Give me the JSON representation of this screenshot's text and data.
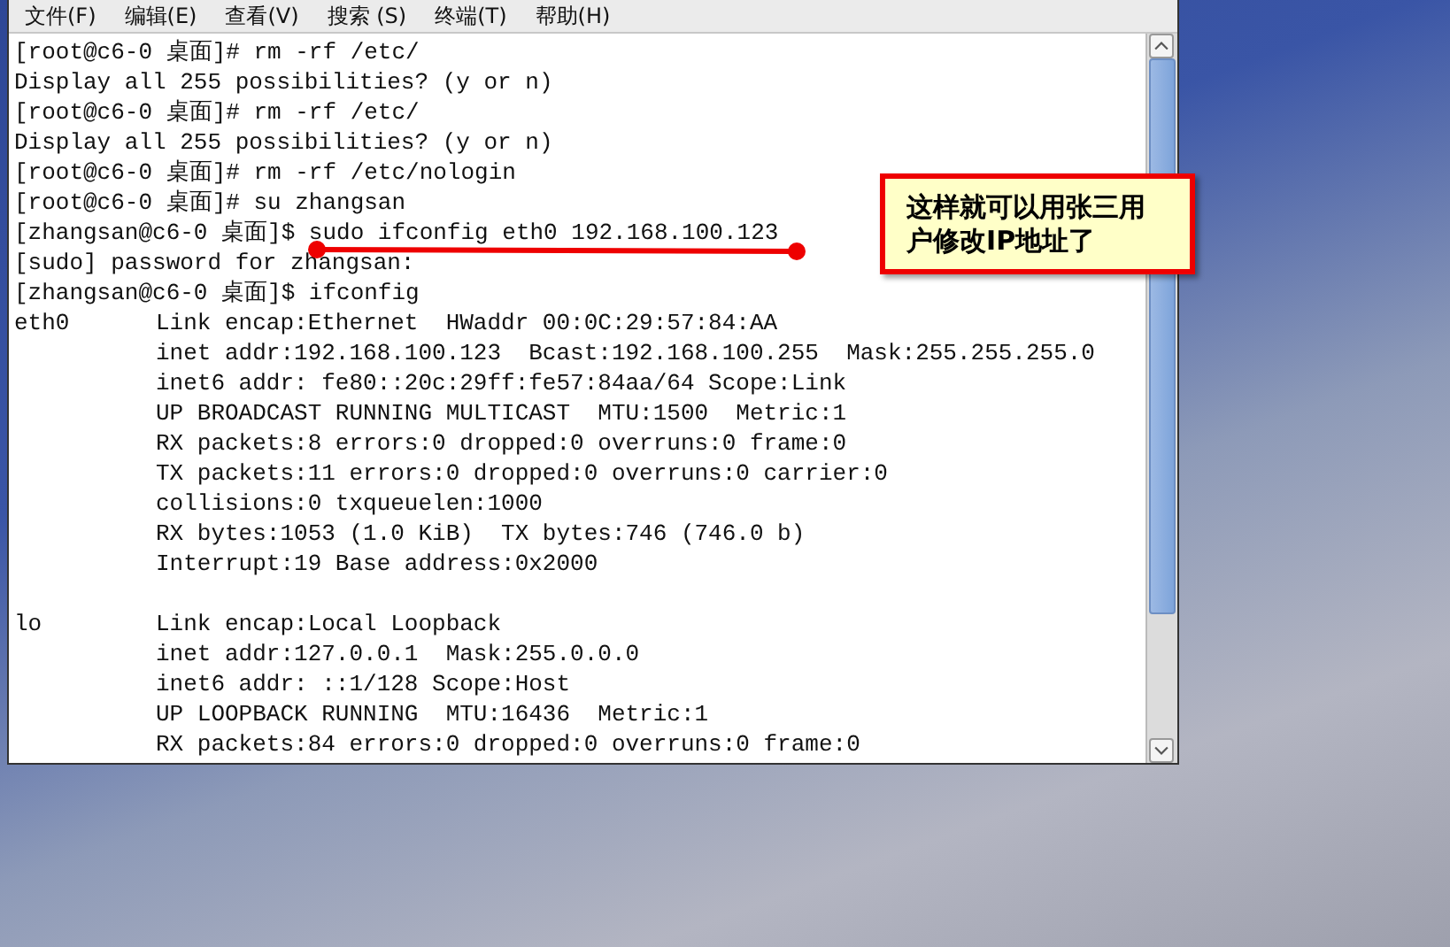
{
  "menu": [
    {
      "label": "文件(F)"
    },
    {
      "label": "编辑(E)"
    },
    {
      "label": "查看(V)"
    },
    {
      "label": "搜索 (S)"
    },
    {
      "label": "终端(T)"
    },
    {
      "label": "帮助(H)"
    }
  ],
  "terminal": {
    "lines": [
      "[root@c6-0 桌面]# rm -rf /etc/",
      "Display all 255 possibilities? (y or n)",
      "[root@c6-0 桌面]# rm -rf /etc/",
      "Display all 255 possibilities? (y or n)",
      "[root@c6-0 桌面]# rm -rf /etc/nologin",
      "[root@c6-0 桌面]# su zhangsan",
      "[zhangsan@c6-0 桌面]$ sudo ifconfig eth0 192.168.100.123",
      "[sudo] password for zhangsan:",
      "[zhangsan@c6-0 桌面]$ ifconfig"
    ],
    "interfaces": [
      {
        "name": "eth0",
        "lines": [
          "Link encap:Ethernet  HWaddr 00:0C:29:57:84:AA",
          "inet addr:192.168.100.123  Bcast:192.168.100.255  Mask:255.255.255.0",
          "inet6 addr: fe80::20c:29ff:fe57:84aa/64 Scope:Link",
          "UP BROADCAST RUNNING MULTICAST  MTU:1500  Metric:1",
          "RX packets:8 errors:0 dropped:0 overruns:0 frame:0",
          "TX packets:11 errors:0 dropped:0 overruns:0 carrier:0",
          "collisions:0 txqueuelen:1000",
          "RX bytes:1053 (1.0 KiB)  TX bytes:746 (746.0 b)",
          "Interrupt:19 Base address:0x2000"
        ]
      },
      {
        "name": "lo",
        "lines": [
          "Link encap:Local Loopback",
          "inet addr:127.0.0.1  Mask:255.0.0.0",
          "inet6 addr: ::1/128 Scope:Host",
          "UP LOOPBACK RUNNING  MTU:16436  Metric:1",
          "RX packets:84 errors:0 dropped:0 overruns:0 frame:0"
        ]
      }
    ]
  },
  "callout": {
    "text": "这样就可以用张三用户修改IP地址了"
  }
}
